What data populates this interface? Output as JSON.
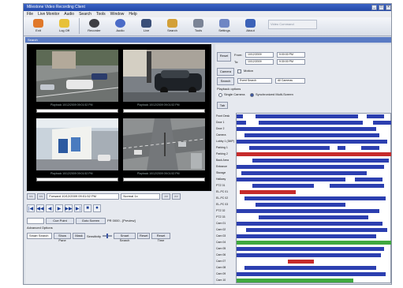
{
  "window": {
    "title": "Milestone Video Recording Client",
    "buttons": [
      "_",
      "□",
      "×"
    ]
  },
  "menu": [
    "File",
    "Live Monitor",
    "Audio",
    "Search",
    "Tools",
    "Window",
    "Help"
  ],
  "toolbar": {
    "items": [
      {
        "label": "Exit",
        "icon": "exit-icon",
        "color": "#e0782a"
      },
      {
        "label": "Log Off",
        "icon": "logoff-icon",
        "color": "#e7c13a"
      },
      {
        "label": "Recorder",
        "icon": "recorder-icon",
        "color": "#3e3f45"
      },
      {
        "label": "Audio",
        "icon": "audio-icon",
        "color": "#4b6bc7"
      },
      {
        "label": "Live",
        "icon": "live-icon",
        "color": "#3a4f78"
      },
      {
        "label": "Search",
        "icon": "search-icon",
        "color": "#d3a038"
      },
      {
        "label": "Tools",
        "icon": "tools-icon",
        "color": "#7b8496"
      },
      {
        "label": "Settings",
        "icon": "settings-icon",
        "color": "#6f86c4"
      },
      {
        "label": "About",
        "icon": "about-icon",
        "color": "#3c62b8"
      }
    ],
    "search_box": "Video Command"
  },
  "panel_title": "Search",
  "cameras": [
    {
      "timestamp": "Playback 10/12/2009 09:01:52 PM"
    },
    {
      "timestamp": "Playback 10/12/2009 09:01:52 PM"
    },
    {
      "timestamp": "Playback 10/12/2009 09:01:52 PM"
    },
    {
      "timestamp": "Playback 10/12/2009 09:01:52 PM"
    }
  ],
  "controls": {
    "prev": "<<",
    "time_field": "Forward 10/12/2009 09:01:52 PM",
    "speed_field": "Normal 1x",
    "next": ">>",
    "media_icons": [
      "|◀",
      "◀◀",
      "◀",
      "▶",
      "▶▶",
      "▶|",
      "■",
      "⏺"
    ],
    "cue_point": "Cue Point",
    "goto_screen": "Goto Screen",
    "status": "PR 0000 - [Preview]",
    "advanced_label": "Advanced Options",
    "smart_search": "Smart Search",
    "show_pane": "Show Pane",
    "mask": "Mask",
    "sensitivity_label": "Sensitivity",
    "smart_search_btn": "Smart Search",
    "reset": "Reset",
    "reset_time": "Reset Time"
  },
  "right_panel": {
    "reset_btn": "Reset",
    "from_label": "From:",
    "to_label": "To:",
    "from_date": "10/12/2009",
    "from_time": "9:00:00 PM",
    "to_date": "10/12/2009",
    "to_time": "9:30:00 PM",
    "camera_btn": "Camera",
    "search_btn": "Search",
    "event_search": "Event Search",
    "motion_label": "Motion",
    "all_cameras": "All Cameras",
    "playback_options": "Playback options",
    "single_camera": "Single Camera",
    "synchronized": "Synchronized Multi-Screen",
    "tab": "Tab"
  },
  "timeline": {
    "colors": {
      "recording": "#2c3fb0",
      "motion": "#c62b2b",
      "event": "#3fa83f",
      "empty": "#ffffff"
    },
    "rows": [
      {
        "name": "Front Desk",
        "type": "recording",
        "segments": [
          [
            0.0,
            0.04
          ],
          [
            0.12,
            0.78
          ],
          [
            0.84,
            0.95
          ]
        ]
      },
      {
        "name": "Door 1",
        "type": "recording",
        "segments": [
          [
            0.0,
            0.06
          ],
          [
            0.14,
            0.81
          ],
          [
            0.88,
            1.0
          ]
        ]
      },
      {
        "name": "Door 2",
        "type": "recording",
        "segments": [
          [
            0.0,
            0.9
          ]
        ]
      },
      {
        "name": "Camera",
        "type": "recording",
        "segments": [
          [
            0.05,
            0.92
          ]
        ]
      },
      {
        "name": "Lobby 1 (3MP)",
        "type": "recording",
        "segments": [
          [
            0.0,
            0.97
          ]
        ]
      },
      {
        "name": "Parking 1",
        "type": "recording",
        "segments": [
          [
            0.08,
            0.6
          ],
          [
            0.65,
            0.7
          ],
          [
            0.8,
            0.92
          ]
        ]
      },
      {
        "name": "Parking 2",
        "type": "motion",
        "segments": [
          [
            0.0,
            0.58
          ],
          [
            0.58,
            0.75
          ],
          [
            0.75,
            1.0
          ]
        ]
      },
      {
        "name": "Back Area",
        "type": "recording",
        "segments": [
          [
            0.1,
            0.98
          ]
        ]
      },
      {
        "name": "Entrance",
        "type": "recording",
        "segments": [
          [
            0.0,
            0.95
          ]
        ]
      },
      {
        "name": "Storage",
        "type": "recording",
        "segments": [
          [
            0.03,
            0.84
          ]
        ]
      },
      {
        "name": "Hallway",
        "type": "recording",
        "segments": [
          [
            0.0,
            0.7
          ],
          [
            0.76,
            0.94
          ]
        ]
      },
      {
        "name": "PTZ 01",
        "type": "recording",
        "segments": [
          [
            0.1,
            0.5
          ],
          [
            0.6,
            0.95
          ]
        ]
      },
      {
        "name": "EL-PC 01",
        "type": "motion",
        "segments": [
          [
            0.02,
            0.38
          ]
        ]
      },
      {
        "name": "EL-PC 02",
        "type": "recording",
        "segments": [
          [
            0.05,
            0.96
          ]
        ]
      },
      {
        "name": "EL-PC 03",
        "type": "recording",
        "segments": [
          [
            0.12,
            0.7
          ]
        ]
      },
      {
        "name": "PTZ 02",
        "type": "recording",
        "segments": [
          [
            0.0,
            0.92
          ]
        ]
      },
      {
        "name": "PTZ 03",
        "type": "recording",
        "segments": [
          [
            0.14,
            0.85
          ]
        ]
      },
      {
        "name": "Cam 01",
        "type": "recording",
        "segments": [
          [
            0.0,
            0.94
          ]
        ]
      },
      {
        "name": "Cam 02",
        "type": "recording",
        "segments": [
          [
            0.06,
            0.97
          ]
        ]
      },
      {
        "name": "Cam 03",
        "type": "recording",
        "segments": [
          [
            0.0,
            0.9
          ]
        ]
      },
      {
        "name": "Cam 04",
        "type": "event",
        "segments": [
          [
            0.0,
            1.0
          ]
        ]
      },
      {
        "name": "Cam 05",
        "type": "recording",
        "segments": [
          [
            0.0,
            0.95
          ]
        ]
      },
      {
        "name": "Cam 06",
        "type": "recording",
        "segments": [
          [
            0.0,
            0.93
          ]
        ]
      },
      {
        "name": "Cam 07",
        "type": "motion",
        "segments": [
          [
            0.33,
            0.5
          ]
        ]
      },
      {
        "name": "Cam 08",
        "type": "recording",
        "segments": [
          [
            0.05,
            0.9
          ]
        ]
      },
      {
        "name": "Cam 09",
        "type": "recording",
        "segments": [
          [
            0.0,
            0.96
          ]
        ]
      },
      {
        "name": "Cam 10",
        "type": "event",
        "segments": [
          [
            0.0,
            0.75
          ]
        ]
      }
    ]
  }
}
